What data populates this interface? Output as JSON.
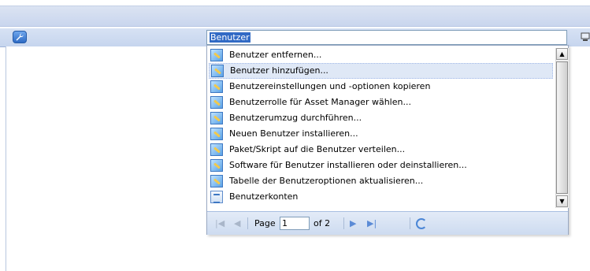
{
  "search": {
    "value": "Benutzer"
  },
  "dropdown": {
    "items": [
      {
        "label": "Benutzer entfernen...",
        "icon": "wizard-icon"
      },
      {
        "label": "Benutzer hinzufügen...",
        "icon": "wizard-icon",
        "highlighted": true
      },
      {
        "label": "Benutzereinstellungen und -optionen kopieren",
        "icon": "wizard-icon"
      },
      {
        "label": "Benutzerrolle für Asset Manager wählen...",
        "icon": "wizard-icon"
      },
      {
        "label": "Benutzerumzug durchführen...",
        "icon": "wizard-icon"
      },
      {
        "label": "Neuen Benutzer installieren...",
        "icon": "wizard-icon"
      },
      {
        "label": "Paket/Skript auf die Benutzer verteilen...",
        "icon": "wizard-icon"
      },
      {
        "label": "Software für Benutzer installieren oder deinstallieren...",
        "icon": "wizard-icon"
      },
      {
        "label": "Tabelle der Benutzeroptionen aktualisieren...",
        "icon": "wizard-icon"
      },
      {
        "label": "Benutzerkonten",
        "icon": "table-icon"
      }
    ]
  },
  "pager": {
    "page_label": "Page",
    "page_value": "1",
    "of_label": "of 2"
  },
  "icons": {
    "toolbar_left": "wrench-icon",
    "toolbar_right": "computer-icon"
  },
  "colors": {
    "selection": "#316ac5",
    "highlight": "#dfe8f6",
    "toolbar": "#c6d5ee"
  }
}
